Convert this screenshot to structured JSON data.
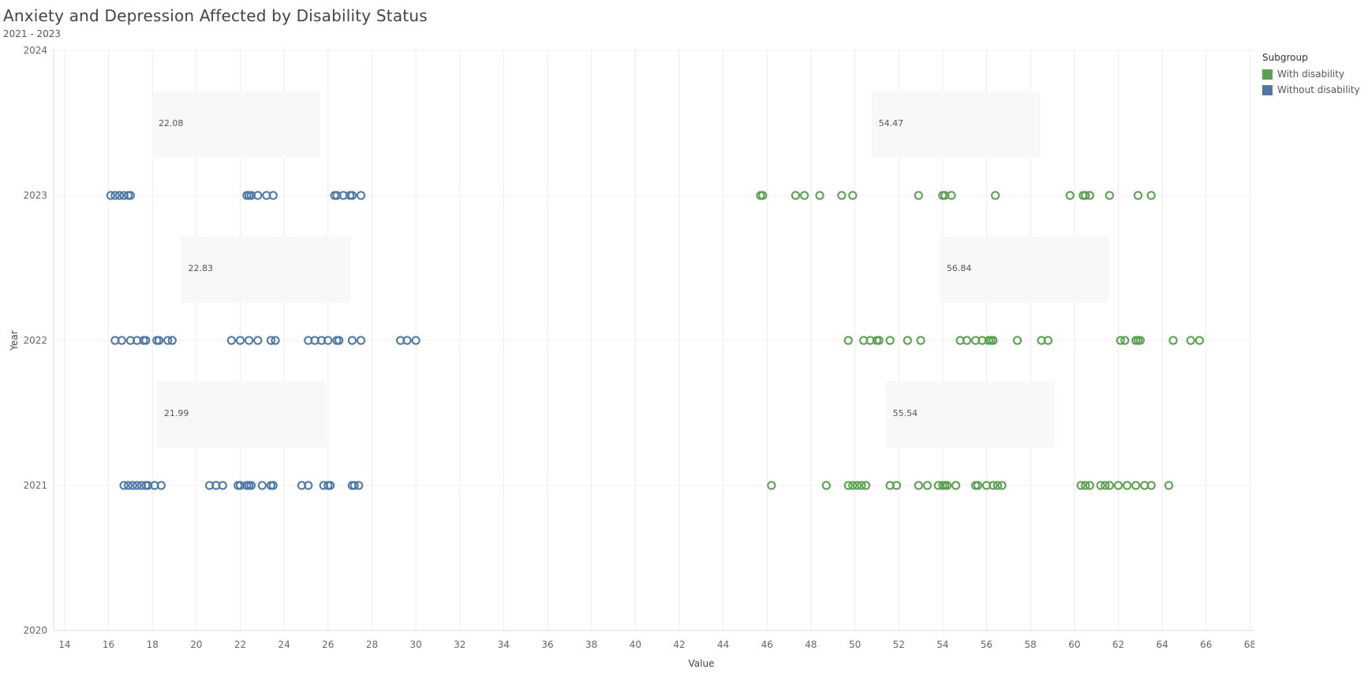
{
  "title": "Anxiety and Depression Affected by Disability Status",
  "subtitle": "2021 - 2023",
  "legend": {
    "title": "Subgroup",
    "items": [
      {
        "label": "With disability",
        "color": "#59a14f"
      },
      {
        "label": "Without disability",
        "color": "#4e79a7"
      }
    ]
  },
  "chart_data": {
    "type": "scatter",
    "xlabel": "Value",
    "ylabel": "Year",
    "xlim": [
      13.5,
      68.2
    ],
    "ylim": [
      2020,
      2024
    ],
    "x_ticks": [
      14,
      16,
      18,
      20,
      22,
      24,
      26,
      28,
      30,
      32,
      34,
      36,
      38,
      40,
      42,
      44,
      46,
      48,
      50,
      52,
      54,
      56,
      58,
      60,
      62,
      64,
      66,
      68
    ],
    "y_ticks": [
      2020,
      2021,
      2022,
      2023,
      2024
    ],
    "grid": true,
    "legend_position": "right",
    "series": [
      {
        "name": "Without disability",
        "color": "#4e79a7",
        "points": [
          {
            "year": 2023,
            "values": [
              16.1,
              16.3,
              16.5,
              16.7,
              16.9,
              17.0,
              22.3,
              22.4,
              22.5,
              22.8,
              23.2,
              23.5,
              26.3,
              26.4,
              26.7,
              27.0,
              27.1,
              27.5
            ]
          },
          {
            "year": 2022,
            "values": [
              16.3,
              16.6,
              17.0,
              17.3,
              17.6,
              17.7,
              18.2,
              18.3,
              18.7,
              18.9,
              21.6,
              22.0,
              22.4,
              22.8,
              23.4,
              23.6,
              25.1,
              25.4,
              25.7,
              26.0,
              26.4,
              26.5,
              27.1,
              27.5,
              29.3,
              29.6,
              30.0
            ]
          },
          {
            "year": 2021,
            "values": [
              16.7,
              16.9,
              17.1,
              17.3,
              17.5,
              17.7,
              17.8,
              18.1,
              18.4,
              20.6,
              20.9,
              21.2,
              21.9,
              22.0,
              22.3,
              22.4,
              22.5,
              23.0,
              23.4,
              23.5,
              24.8,
              25.1,
              25.8,
              26.0,
              26.1,
              27.1,
              27.2,
              27.4
            ]
          }
        ]
      },
      {
        "name": "With disability",
        "color": "#59a14f",
        "points": [
          {
            "year": 2023,
            "values": [
              45.7,
              45.8,
              47.3,
              47.7,
              48.4,
              49.4,
              49.9,
              52.9,
              54.0,
              54.1,
              54.4,
              56.4,
              59.8,
              60.4,
              60.5,
              60.7,
              61.6,
              62.9,
              63.5
            ]
          },
          {
            "year": 2022,
            "values": [
              49.7,
              50.4,
              50.7,
              51.0,
              51.1,
              51.6,
              52.4,
              53.0,
              54.8,
              55.1,
              55.5,
              55.8,
              56.1,
              56.2,
              56.3,
              57.4,
              58.5,
              58.8,
              62.1,
              62.3,
              62.8,
              62.9,
              63.0,
              64.5,
              65.3,
              65.7
            ]
          },
          {
            "year": 2021,
            "values": [
              46.2,
              48.7,
              49.7,
              49.9,
              50.1,
              50.3,
              50.5,
              51.6,
              51.9,
              52.9,
              53.3,
              53.8,
              54.0,
              54.1,
              54.2,
              54.6,
              55.5,
              55.6,
              56.0,
              56.3,
              56.5,
              56.7,
              60.3,
              60.5,
              60.7,
              61.2,
              61.4,
              61.6,
              62.0,
              62.4,
              62.8,
              63.2,
              63.5,
              64.3
            ]
          }
        ]
      }
    ],
    "annotations": [
      {
        "label": "22.08",
        "year": 2023,
        "series": "Without disability"
      },
      {
        "label": "22.83",
        "year": 2022,
        "series": "Without disability"
      },
      {
        "label": "21.99",
        "year": 2021,
        "series": "Without disability"
      },
      {
        "label": "54.47",
        "year": 2023,
        "series": "With disability"
      },
      {
        "label": "56.84",
        "year": 2022,
        "series": "With disability"
      },
      {
        "label": "55.54",
        "year": 2021,
        "series": "With disability"
      }
    ]
  }
}
